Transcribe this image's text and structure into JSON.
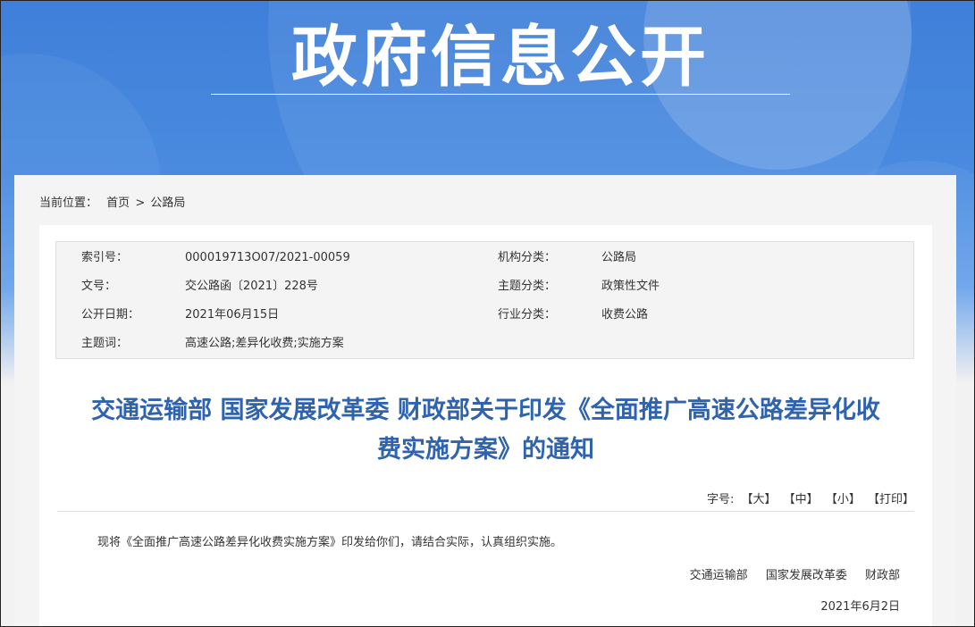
{
  "banner": {
    "title": "政府信息公开"
  },
  "breadcrumb": {
    "prefix": "当前位置：",
    "home": "首页",
    "separator": ">",
    "current": "公路局"
  },
  "meta": {
    "index_label": "索引号：",
    "index_value": "000019713O07/2021-00059",
    "org_label": "机构分类：",
    "org_value": "公路局",
    "docno_label": "文号：",
    "docno_value": "交公路函〔2021〕228号",
    "topic_label": "主题分类：",
    "topic_value": "政策性文件",
    "date_label": "公开日期：",
    "date_value": "2021年06月15日",
    "industry_label": "行业分类：",
    "industry_value": "收费公路",
    "keywords_label": "主题词：",
    "keywords_value": "高速公路;差异化收费;实施方案"
  },
  "document": {
    "title_line1": "交通运输部 国家发展改革委 财政部关于印发《全面推广高速公路差异化收",
    "title_line2": "费实施方案》的通知",
    "body": "现将《全面推广高速公路差异化收费实施方案》印发给你们，请结合实际，认真组织实施。",
    "signers": [
      "交通运输部",
      "国家发展改革委",
      "财政部"
    ],
    "date": "2021年6月2日"
  },
  "font_tools": {
    "label": "字号:",
    "large": "【大】",
    "medium": "【中】",
    "small": "【小】",
    "print": "【打印】"
  }
}
